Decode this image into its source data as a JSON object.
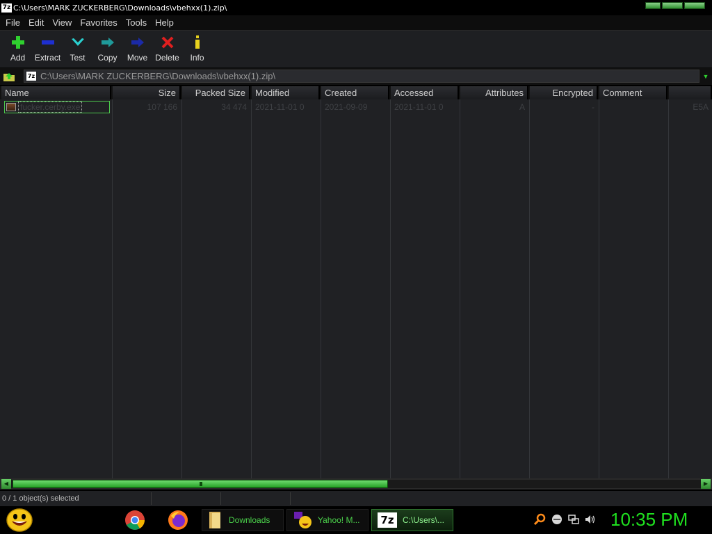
{
  "window": {
    "title": "C:\\Users\\MARK ZUCKERBERG\\Downloads\\vbehxx(1).zip\\",
    "app_icon_text": "7z"
  },
  "menu": [
    "File",
    "Edit",
    "View",
    "Favorites",
    "Tools",
    "Help"
  ],
  "toolbar": [
    {
      "label": "Add",
      "icon": "plus-icon"
    },
    {
      "label": "Extract",
      "icon": "minus-icon"
    },
    {
      "label": "Test",
      "icon": "check-icon"
    },
    {
      "label": "Copy",
      "icon": "double-arrow-right-icon"
    },
    {
      "label": "Move",
      "icon": "arrow-right-icon"
    },
    {
      "label": "Delete",
      "icon": "x-icon"
    },
    {
      "label": "Info",
      "icon": "info-icon"
    }
  ],
  "address": {
    "path": "C:\\Users\\MARK ZUCKERBERG\\Downloads\\vbehxx(1).zip\\",
    "icon_text": "7z"
  },
  "columns": [
    "Name",
    "Size",
    "Packed Size",
    "Modified",
    "Created",
    "Accessed",
    "Attributes",
    "Encrypted",
    "Comment",
    ""
  ],
  "files": [
    {
      "name": "fucker.cerby.exe",
      "size": "107 166",
      "packed_size": "34 474",
      "modified": "2021-11-01 0",
      "created": "2021-09-09",
      "accessed": "2021-11-01 0",
      "attributes": "A",
      "encrypted": "-",
      "comment": "",
      "crc": "E5A"
    }
  ],
  "status": {
    "selection": "0 / 1 object(s) selected"
  },
  "taskbar": {
    "items": [
      {
        "label": "Downloads"
      },
      {
        "label": "Yahoo! M..."
      },
      {
        "label": "C:\\Users\\..."
      }
    ],
    "clock": "10:35 PM"
  },
  "colors": {
    "accent": "#2fd02f",
    "background": "#202124"
  }
}
